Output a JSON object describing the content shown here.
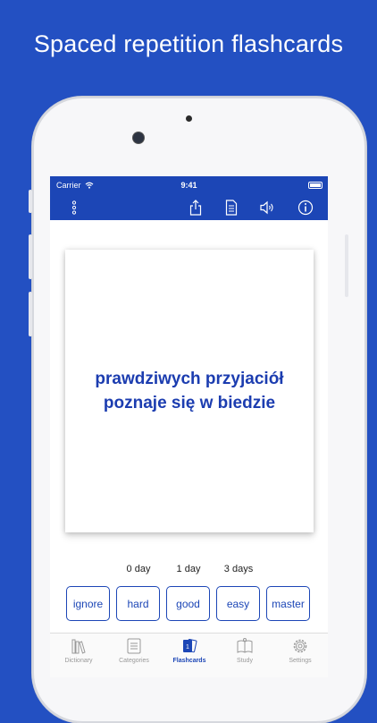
{
  "headline": "Spaced repetition flashcards",
  "status_bar": {
    "carrier": "Carrier",
    "time": "9:41"
  },
  "toolbar": {
    "menu_icon": "vertical-dots-icon",
    "share_icon": "share-icon",
    "document_icon": "document-icon",
    "sound_icon": "speaker-icon",
    "info_icon": "info-icon"
  },
  "card": {
    "line1": "prawdziwych przyjaciół",
    "line2": "poznaje się w biedzie"
  },
  "intervals": [
    "0 day",
    "1 day",
    "3 days"
  ],
  "grade_buttons": [
    "ignore",
    "hard",
    "good",
    "easy",
    "master"
  ],
  "tabs": [
    {
      "label": "Dictionary",
      "icon": "books-icon"
    },
    {
      "label": "Categories",
      "icon": "list-icon"
    },
    {
      "label": "Flashcards",
      "icon": "flashcards-icon",
      "badge": "1",
      "active": true
    },
    {
      "label": "Study",
      "icon": "study-icon"
    },
    {
      "label": "Settings",
      "icon": "gear-icon"
    }
  ],
  "colors": {
    "brand": "#1c46b6",
    "background": "#2350c2"
  }
}
